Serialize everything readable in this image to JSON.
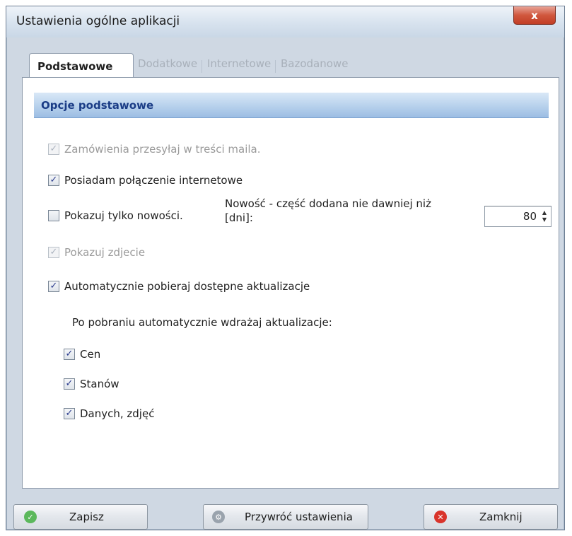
{
  "window": {
    "title": "Ustawienia ogólne aplikacji",
    "close_label": "x"
  },
  "tabs": [
    {
      "label": "Podstawowe",
      "active": true
    },
    {
      "label": "Dodatkowe",
      "active": false
    },
    {
      "label": "Internetowe",
      "active": false
    },
    {
      "label": "Bazodanowe",
      "active": false
    }
  ],
  "section": {
    "title": "Opcje podstawowe"
  },
  "options": {
    "orders_in_mail": {
      "label": "Zamówienia przesyłaj w treści maila.",
      "checked": true,
      "enabled": false
    },
    "internet_connection": {
      "label": "Posiadam połączenie internetowe",
      "checked": true,
      "enabled": true
    },
    "show_new_only": {
      "label": "Pokazuj tylko nowości.",
      "checked": false,
      "enabled": true
    },
    "show_photo": {
      "label": "Pokazuj zdjecie",
      "checked": true,
      "enabled": false
    },
    "auto_download": {
      "label": "Automatycznie pobieraj dostępne aktualizacje",
      "checked": true,
      "enabled": true
    },
    "auto_deploy_label": "Po pobraniu automatycznie wdrażaj aktualizacje:",
    "deploy_prices": {
      "label": "Cen",
      "checked": true,
      "enabled": true
    },
    "deploy_stock": {
      "label": "Stanów",
      "checked": true,
      "enabled": true
    },
    "deploy_data_photos": {
      "label": "Danych, zdjęć",
      "checked": true,
      "enabled": true
    }
  },
  "novelty": {
    "label_line1": "Nowość - część dodana nie dawniej niż",
    "label_line2": "[dni]:",
    "days": "80"
  },
  "buttons": {
    "save": "Zapisz",
    "restore": "Przywróć ustawienia",
    "close": "Zamknij"
  },
  "colors": {
    "save_icon": "#5cb85c",
    "restore_icon": "#9aa3ad",
    "close_icon": "#d9342b",
    "section_title": "#1a3c86"
  },
  "icons": {
    "save": "check-circle-icon",
    "restore": "gear-icon",
    "close": "x-circle-icon"
  }
}
